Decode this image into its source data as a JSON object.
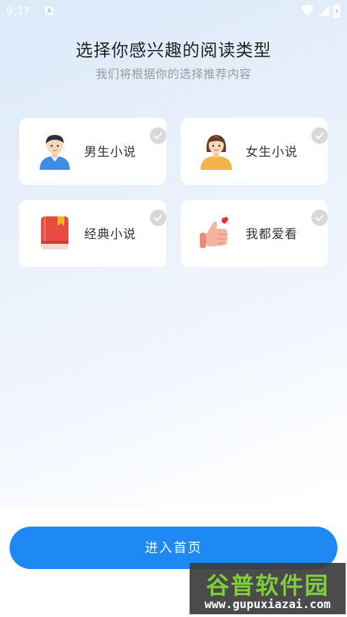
{
  "status_bar": {
    "time": "9:37",
    "notification_letter": "A",
    "icons": [
      "wifi-icon",
      "signal-icon",
      "battery-icon"
    ]
  },
  "header": {
    "title": "选择你感兴趣的阅读类型",
    "subtitle": "我们将根据你的选择推荐内容"
  },
  "options": [
    {
      "label": "男生小说",
      "icon": "male-avatar-icon",
      "selected": false
    },
    {
      "label": "女生小说",
      "icon": "female-avatar-icon",
      "selected": false
    },
    {
      "label": "经典小说",
      "icon": "red-book-icon",
      "selected": false
    },
    {
      "label": "我都爱看",
      "icon": "thumbs-up-heart-icon",
      "selected": false
    }
  ],
  "footer": {
    "enter_label": "进入首页"
  },
  "watermark": {
    "title": "谷普软件园",
    "url": "www.gupuxiazai.com"
  },
  "colors": {
    "accent": "#1e88f5",
    "check_unselected": "#d8d8d8",
    "watermark_green": "#7fcf3a"
  }
}
